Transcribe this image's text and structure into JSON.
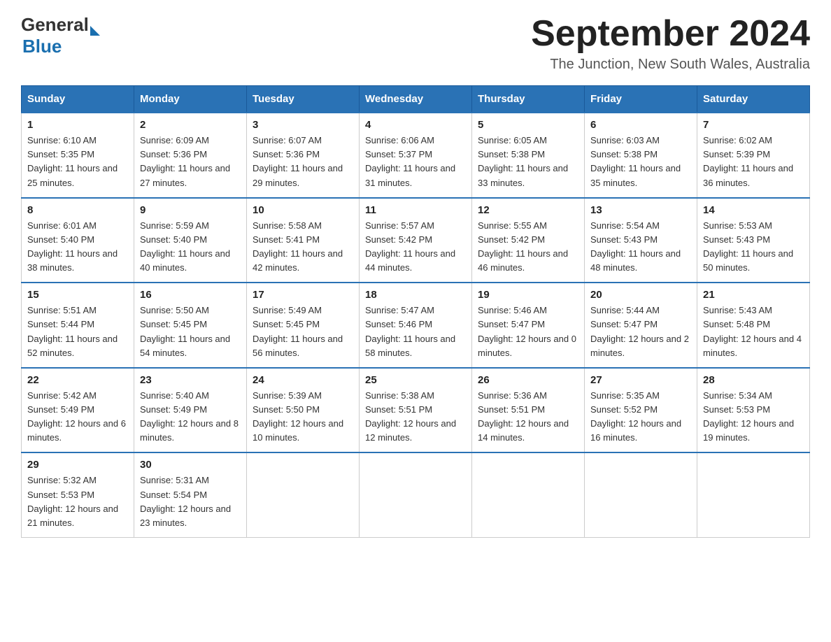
{
  "header": {
    "logo_general": "General",
    "logo_blue": "Blue",
    "month_title": "September 2024",
    "location": "The Junction, New South Wales, Australia"
  },
  "days_of_week": [
    "Sunday",
    "Monday",
    "Tuesday",
    "Wednesday",
    "Thursday",
    "Friday",
    "Saturday"
  ],
  "weeks": [
    [
      {
        "day": "1",
        "sunrise": "6:10 AM",
        "sunset": "5:35 PM",
        "daylight": "11 hours and 25 minutes."
      },
      {
        "day": "2",
        "sunrise": "6:09 AM",
        "sunset": "5:36 PM",
        "daylight": "11 hours and 27 minutes."
      },
      {
        "day": "3",
        "sunrise": "6:07 AM",
        "sunset": "5:36 PM",
        "daylight": "11 hours and 29 minutes."
      },
      {
        "day": "4",
        "sunrise": "6:06 AM",
        "sunset": "5:37 PM",
        "daylight": "11 hours and 31 minutes."
      },
      {
        "day": "5",
        "sunrise": "6:05 AM",
        "sunset": "5:38 PM",
        "daylight": "11 hours and 33 minutes."
      },
      {
        "day": "6",
        "sunrise": "6:03 AM",
        "sunset": "5:38 PM",
        "daylight": "11 hours and 35 minutes."
      },
      {
        "day": "7",
        "sunrise": "6:02 AM",
        "sunset": "5:39 PM",
        "daylight": "11 hours and 36 minutes."
      }
    ],
    [
      {
        "day": "8",
        "sunrise": "6:01 AM",
        "sunset": "5:40 PM",
        "daylight": "11 hours and 38 minutes."
      },
      {
        "day": "9",
        "sunrise": "5:59 AM",
        "sunset": "5:40 PM",
        "daylight": "11 hours and 40 minutes."
      },
      {
        "day": "10",
        "sunrise": "5:58 AM",
        "sunset": "5:41 PM",
        "daylight": "11 hours and 42 minutes."
      },
      {
        "day": "11",
        "sunrise": "5:57 AM",
        "sunset": "5:42 PM",
        "daylight": "11 hours and 44 minutes."
      },
      {
        "day": "12",
        "sunrise": "5:55 AM",
        "sunset": "5:42 PM",
        "daylight": "11 hours and 46 minutes."
      },
      {
        "day": "13",
        "sunrise": "5:54 AM",
        "sunset": "5:43 PM",
        "daylight": "11 hours and 48 minutes."
      },
      {
        "day": "14",
        "sunrise": "5:53 AM",
        "sunset": "5:43 PM",
        "daylight": "11 hours and 50 minutes."
      }
    ],
    [
      {
        "day": "15",
        "sunrise": "5:51 AM",
        "sunset": "5:44 PM",
        "daylight": "11 hours and 52 minutes."
      },
      {
        "day": "16",
        "sunrise": "5:50 AM",
        "sunset": "5:45 PM",
        "daylight": "11 hours and 54 minutes."
      },
      {
        "day": "17",
        "sunrise": "5:49 AM",
        "sunset": "5:45 PM",
        "daylight": "11 hours and 56 minutes."
      },
      {
        "day": "18",
        "sunrise": "5:47 AM",
        "sunset": "5:46 PM",
        "daylight": "11 hours and 58 minutes."
      },
      {
        "day": "19",
        "sunrise": "5:46 AM",
        "sunset": "5:47 PM",
        "daylight": "12 hours and 0 minutes."
      },
      {
        "day": "20",
        "sunrise": "5:44 AM",
        "sunset": "5:47 PM",
        "daylight": "12 hours and 2 minutes."
      },
      {
        "day": "21",
        "sunrise": "5:43 AM",
        "sunset": "5:48 PM",
        "daylight": "12 hours and 4 minutes."
      }
    ],
    [
      {
        "day": "22",
        "sunrise": "5:42 AM",
        "sunset": "5:49 PM",
        "daylight": "12 hours and 6 minutes."
      },
      {
        "day": "23",
        "sunrise": "5:40 AM",
        "sunset": "5:49 PM",
        "daylight": "12 hours and 8 minutes."
      },
      {
        "day": "24",
        "sunrise": "5:39 AM",
        "sunset": "5:50 PM",
        "daylight": "12 hours and 10 minutes."
      },
      {
        "day": "25",
        "sunrise": "5:38 AM",
        "sunset": "5:51 PM",
        "daylight": "12 hours and 12 minutes."
      },
      {
        "day": "26",
        "sunrise": "5:36 AM",
        "sunset": "5:51 PM",
        "daylight": "12 hours and 14 minutes."
      },
      {
        "day": "27",
        "sunrise": "5:35 AM",
        "sunset": "5:52 PM",
        "daylight": "12 hours and 16 minutes."
      },
      {
        "day": "28",
        "sunrise": "5:34 AM",
        "sunset": "5:53 PM",
        "daylight": "12 hours and 19 minutes."
      }
    ],
    [
      {
        "day": "29",
        "sunrise": "5:32 AM",
        "sunset": "5:53 PM",
        "daylight": "12 hours and 21 minutes."
      },
      {
        "day": "30",
        "sunrise": "5:31 AM",
        "sunset": "5:54 PM",
        "daylight": "12 hours and 23 minutes."
      },
      null,
      null,
      null,
      null,
      null
    ]
  ]
}
